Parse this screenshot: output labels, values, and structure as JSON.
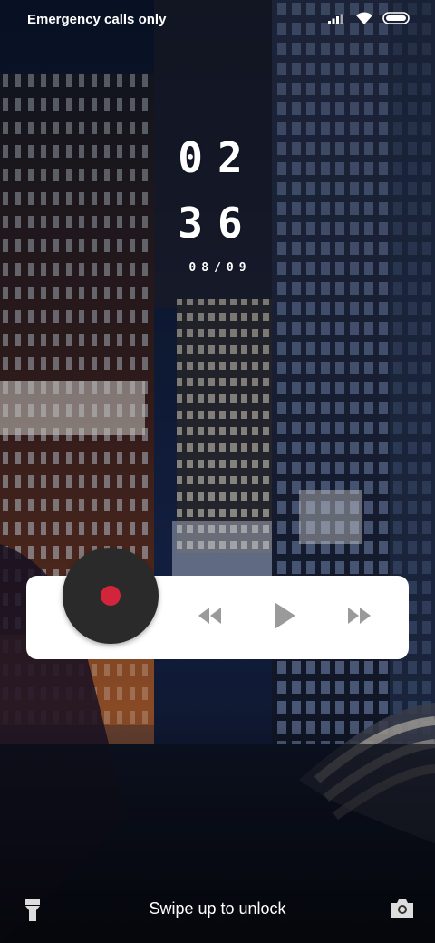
{
  "status_bar": {
    "carrier_text": "Emergency calls only",
    "icons": [
      "signal-icon",
      "wifi-icon",
      "battery-icon"
    ]
  },
  "clock": {
    "hours": "02",
    "minutes": "36",
    "date": "08/09"
  },
  "music_player": {
    "icons": [
      "vinyl-disc-icon",
      "previous-icon",
      "play-icon",
      "next-icon"
    ],
    "accent_color": "#d2253c",
    "control_color": "#9a9a9a"
  },
  "bottom_bar": {
    "unlock_hint": "Swipe up to unlock",
    "icons": [
      "flashlight-icon",
      "camera-icon"
    ]
  }
}
